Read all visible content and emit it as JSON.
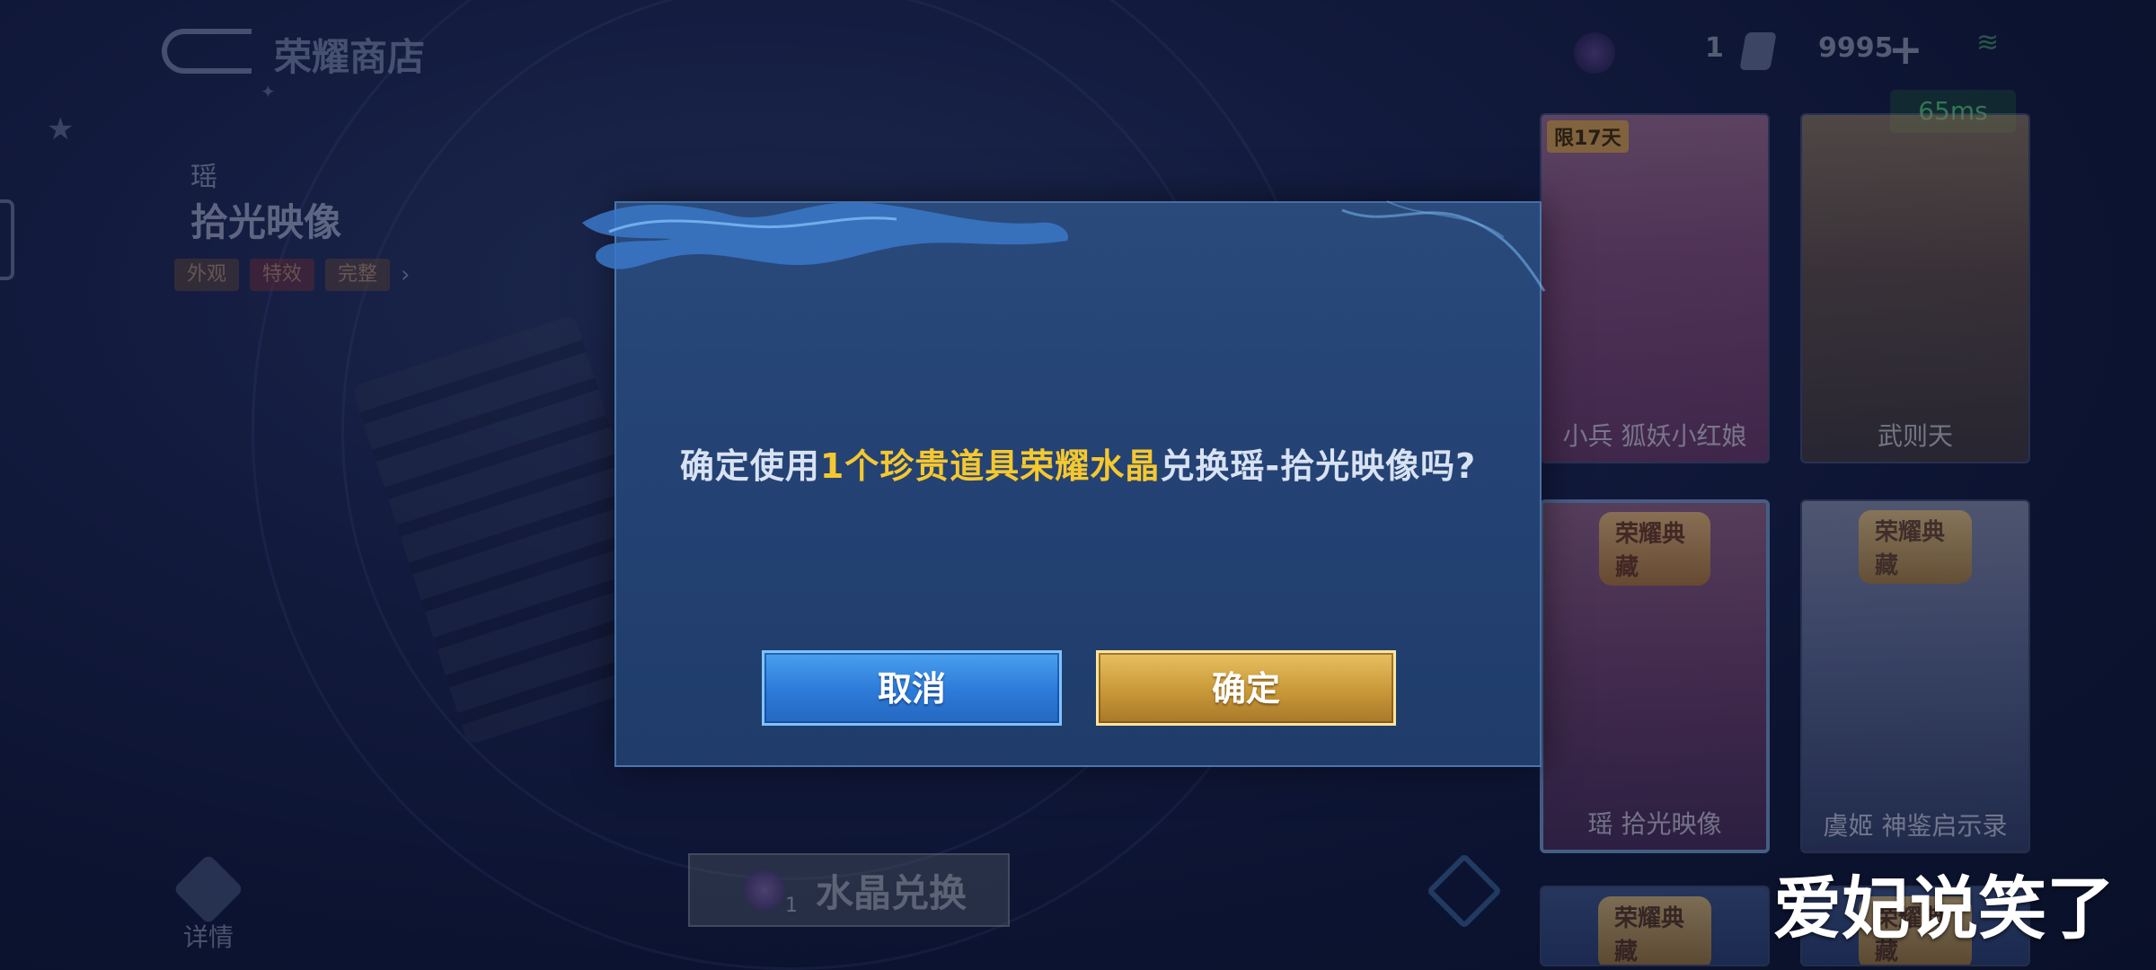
{
  "header": {
    "store_title": "荣耀商店",
    "ticket_count": "1",
    "coupon_count": "9995",
    "ping": "65ms"
  },
  "hero": {
    "name": "瑶",
    "skin": "拾光映像",
    "tags": [
      "外观",
      "特效",
      "完整"
    ]
  },
  "bottom": {
    "details_label": "详情",
    "exchange_label": "水晶兑换",
    "exchange_count": "1"
  },
  "cards": [
    {
      "label": "小兵 狐妖小红娘",
      "badge": "限17天",
      "banner": ""
    },
    {
      "label": "武则天",
      "badge": "",
      "banner": ""
    },
    {
      "label": "瑶 拾光映像",
      "badge": "",
      "banner": "荣耀典藏"
    },
    {
      "label": "虞姬 神鉴启示录",
      "badge": "",
      "banner": "荣耀典藏"
    },
    {
      "label": "",
      "badge": "",
      "banner": "荣耀典藏"
    },
    {
      "label": "",
      "badge": "",
      "banner": "荣耀典藏"
    }
  ],
  "dialog": {
    "message_prefix": "确定使用",
    "message_highlight": "1个珍贵道具荣耀水晶",
    "message_suffix": "兑换瑶-拾光映像吗?",
    "cancel_label": "取消",
    "confirm_label": "确定"
  },
  "watermark": "爱妃说笑了",
  "colors": {
    "highlight": "#f5c830",
    "cancel_button": "#2c7ad8",
    "confirm_button": "#c89838",
    "dialog_bg": "#244274"
  }
}
